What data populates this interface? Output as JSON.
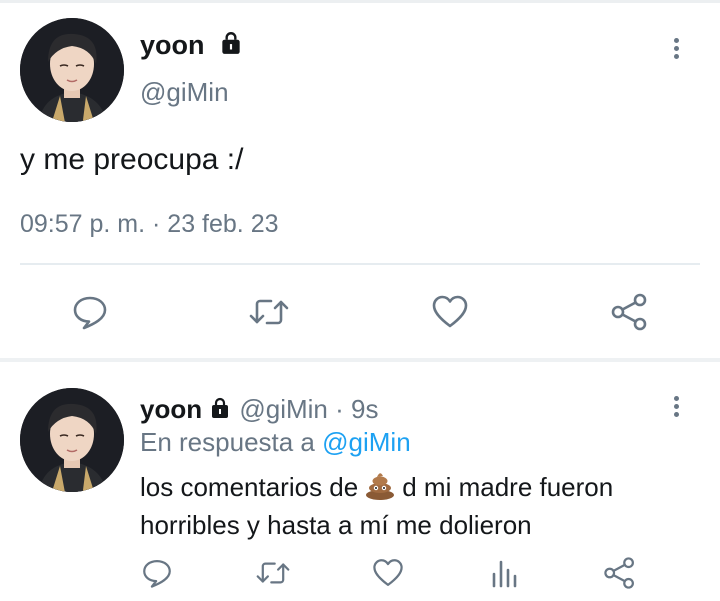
{
  "tweet": {
    "name": "yoon",
    "handle": "@giMin",
    "text": "y me preocupa :/",
    "timestamp": "09:57 p. m. · 23 feb. 23"
  },
  "reply": {
    "name": "yoon",
    "handle": "@giMin",
    "age": "· 9s",
    "reply_prefix": "En respuesta a",
    "reply_to": "@giMin",
    "text_before_emoji": "los comentarios de",
    "emoji": "poop-emoji",
    "text_after_emoji": "d mi madre fueron horribles y hasta a mí me dolieron"
  },
  "colors": {
    "muted": "#687684",
    "link": "#1da1f2",
    "text": "#14171a"
  },
  "icons": [
    "lock-icon",
    "more-icon",
    "reply-icon",
    "retweet-icon",
    "like-icon",
    "share-icon",
    "analytics-icon"
  ]
}
